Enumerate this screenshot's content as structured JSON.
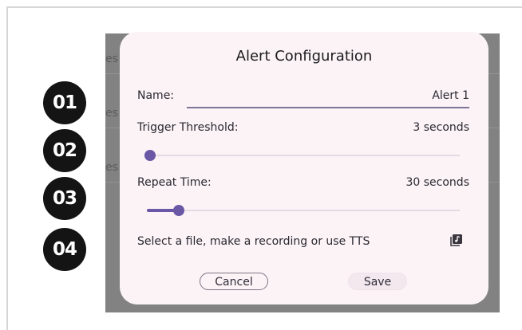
{
  "badges": [
    "01",
    "02",
    "03",
    "04"
  ],
  "background": {
    "clipped_fragments": [
      "es",
      "es",
      "es"
    ]
  },
  "dialog": {
    "title": "Alert Configuration",
    "name": {
      "label": "Name:",
      "value": "Alert 1"
    },
    "trigger": {
      "label": "Trigger Threshold:",
      "value_text": "3 seconds",
      "slider_fraction": 0.0
    },
    "repeat": {
      "label": "Repeat Time:",
      "value_text": "30 seconds",
      "slider_fraction": 0.1
    },
    "file_prompt": "Select a file, make a recording or use TTS",
    "file_icon": "audio-file-icon",
    "cancel_label": "Cancel",
    "save_label": "Save"
  },
  "colors": {
    "accent": "#6a57a6",
    "dialog_bg": "#fbf3f6",
    "scrim": "#828282",
    "badge": "#141414"
  }
}
